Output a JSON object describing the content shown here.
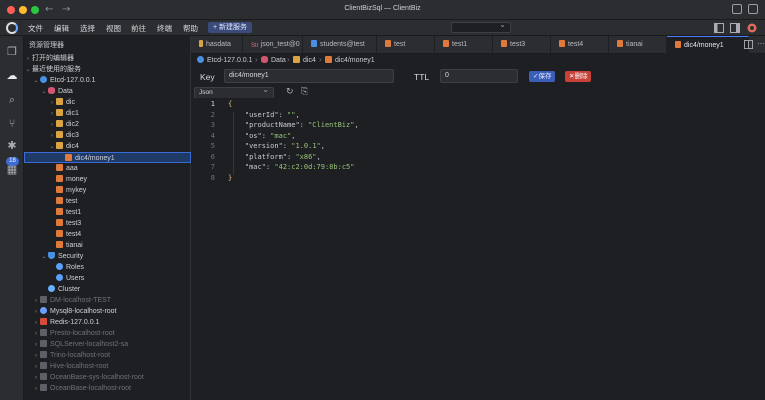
{
  "window": {
    "title": "ClientBizSql — ClientBiz"
  },
  "menu": {
    "items": [
      "文件",
      "编辑",
      "选择",
      "视图",
      "前往",
      "终端",
      "帮助"
    ],
    "new_connection": "+ 新建服务"
  },
  "sidebar": {
    "header": "资源管理器",
    "sections": {
      "open_editors": "打开的编辑器",
      "recent_services": "最近使用的服务"
    },
    "tree": [
      {
        "label": "Etcd-127.0.0.1",
        "depth": 1,
        "twisty": "down",
        "icon": "etcd-icon"
      },
      {
        "label": "Data",
        "depth": 2,
        "twisty": "down",
        "icon": "database-icon"
      },
      {
        "label": "dic",
        "depth": 3,
        "twisty": "right",
        "icon": "folder-icon"
      },
      {
        "label": "dic1",
        "depth": 3,
        "twisty": "right",
        "icon": "folder-icon"
      },
      {
        "label": "dic2",
        "depth": 3,
        "twisty": "right",
        "icon": "folder-icon"
      },
      {
        "label": "dic3",
        "depth": 3,
        "twisty": "right",
        "icon": "folder-icon"
      },
      {
        "label": "dic4",
        "depth": 3,
        "twisty": "down",
        "icon": "folder-icon"
      },
      {
        "label": "dic4/money1",
        "depth": 4,
        "twisty": "",
        "icon": "file-icon",
        "selected": true
      },
      {
        "label": "aaa",
        "depth": 3,
        "twisty": "",
        "icon": "file-icon"
      },
      {
        "label": "money",
        "depth": 3,
        "twisty": "",
        "icon": "file-icon"
      },
      {
        "label": "mykey",
        "depth": 3,
        "twisty": "",
        "icon": "file-icon"
      },
      {
        "label": "test",
        "depth": 3,
        "twisty": "",
        "icon": "file-icon"
      },
      {
        "label": "test1",
        "depth": 3,
        "twisty": "",
        "icon": "file-icon"
      },
      {
        "label": "test3",
        "depth": 3,
        "twisty": "",
        "icon": "file-icon"
      },
      {
        "label": "test4",
        "depth": 3,
        "twisty": "",
        "icon": "file-icon"
      },
      {
        "label": "tianai",
        "depth": 3,
        "twisty": "",
        "icon": "file-icon"
      },
      {
        "label": "Security",
        "depth": 2,
        "twisty": "down",
        "icon": "shield-icon"
      },
      {
        "label": "Roles",
        "depth": 3,
        "twisty": "",
        "icon": "roles-icon"
      },
      {
        "label": "Users",
        "depth": 3,
        "twisty": "",
        "icon": "user-icon"
      },
      {
        "label": "Cluster",
        "depth": 2,
        "twisty": "",
        "icon": "cluster-icon"
      },
      {
        "label": "DM-localhost-TEST",
        "depth": 1,
        "twisty": "right",
        "icon": "dm-icon",
        "dim": true
      },
      {
        "label": "Mysql8-localhost-root",
        "depth": 1,
        "twisty": "right",
        "icon": "mysql-icon"
      },
      {
        "label": "Redis-127.0.0.1",
        "depth": 1,
        "twisty": "right",
        "icon": "redis-icon"
      },
      {
        "label": "Presto-localhost-root",
        "depth": 1,
        "twisty": "right",
        "icon": "presto-icon",
        "dim": true
      },
      {
        "label": "SQLServer-localhost2-sa",
        "depth": 1,
        "twisty": "right",
        "icon": "sqlserver-icon",
        "dim": true
      },
      {
        "label": "Trino-localhost-root",
        "depth": 1,
        "twisty": "right",
        "icon": "trino-icon",
        "dim": true
      },
      {
        "label": "Hive-localhost-root",
        "depth": 1,
        "twisty": "right",
        "icon": "hive-icon",
        "dim": true
      },
      {
        "label": "OceanBase-sys-localhost-root",
        "depth": 1,
        "twisty": "right",
        "icon": "oceanbase-icon",
        "dim": true
      },
      {
        "label": "OceanBase-localhost-root",
        "depth": 1,
        "twisty": "right",
        "icon": "oceanbase-icon",
        "dim": true
      }
    ]
  },
  "tabs": [
    {
      "label": "hasdata",
      "icon": "hash"
    },
    {
      "label": "json_test@0",
      "icon": "str",
      "prefix": "Str"
    },
    {
      "label": "students@test",
      "icon": "table"
    },
    {
      "label": "test",
      "icon": "file"
    },
    {
      "label": "test1",
      "icon": "file"
    },
    {
      "label": "test3",
      "icon": "file"
    },
    {
      "label": "test4",
      "icon": "file"
    },
    {
      "label": "tianai",
      "icon": "file"
    },
    {
      "label": "dic4/money1",
      "icon": "file",
      "active": true
    }
  ],
  "breadcrumb": [
    "Etcd-127.0.0.1",
    "Data",
    "dic4",
    "dic4/money1"
  ],
  "key_panel": {
    "key_label": "Key",
    "key_value": "dic4/money1",
    "ttl_label": "TTL",
    "ttl_value": "0",
    "save_label": "✓保存",
    "delete_label": "✕删除",
    "format": "Json"
  },
  "editor": {
    "line_numbers": [
      "1",
      "2",
      "3",
      "4",
      "5",
      "6",
      "7",
      "8"
    ],
    "lines": [
      {
        "key": "userId",
        "value": "\"\""
      },
      {
        "key": "productName",
        "value": "\"ClientBiz\""
      },
      {
        "key": "os",
        "value": "\"mac\""
      },
      {
        "key": "version",
        "value": "\"1.0.1\""
      },
      {
        "key": "platform",
        "value": "\"x86\""
      },
      {
        "key": "mac",
        "value": "\"42:c2:0d:79:8b:c5\""
      }
    ],
    "open_brace": "{",
    "close_brace": "}"
  },
  "activity": {
    "badge_count": "18"
  },
  "colors": {
    "accent": "#3b6bd6",
    "save": "#3b5eb8",
    "delete": "#c7433a",
    "string": "#98c379",
    "brace": "#e5c07b"
  }
}
